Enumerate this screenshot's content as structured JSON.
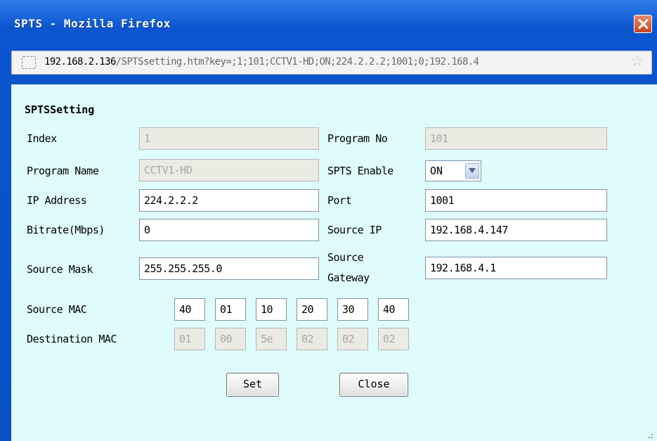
{
  "window": {
    "title": "SPTS - Mozilla Firefox",
    "close_icon": "close-icon"
  },
  "urlbar": {
    "host": "192.168.2.136",
    "path": "/SPTSsetting.htm?key=;1;101;CCTV1-HD;ON;224.2.2.2;1001;0;192.168.4",
    "page_icon": "page-icon",
    "bookmark_icon": "star-icon"
  },
  "form": {
    "heading": "SPTSSetting",
    "index": {
      "label": "Index",
      "value": "1"
    },
    "program_no": {
      "label": "Program No",
      "value": "101"
    },
    "program_name": {
      "label": "Program Name",
      "value": "CCTV1-HD"
    },
    "spts_enable": {
      "label": "SPTS Enable",
      "value": "ON"
    },
    "ip_address": {
      "label": "IP Address",
      "value": "224.2.2.2"
    },
    "port": {
      "label": "Port",
      "value": "1001"
    },
    "bitrate": {
      "label": "Bitrate(Mbps)",
      "value": "0"
    },
    "source_ip": {
      "label": "Source IP",
      "value": "192.168.4.147"
    },
    "source_mask": {
      "label": "Source Mask",
      "value": "255.255.255.0"
    },
    "source_gateway": {
      "label_line1": "Source",
      "label_line2": "Gateway",
      "value": "192.168.4.1"
    },
    "source_mac": {
      "label": "Source MAC",
      "values": [
        "40",
        "01",
        "10",
        "20",
        "30",
        "40"
      ]
    },
    "destination_mac": {
      "label": "Destination MAC",
      "values": [
        "01",
        "00",
        "5e",
        "02",
        "02",
        "02"
      ]
    },
    "set_button": "Set",
    "close_button": "Close"
  }
}
